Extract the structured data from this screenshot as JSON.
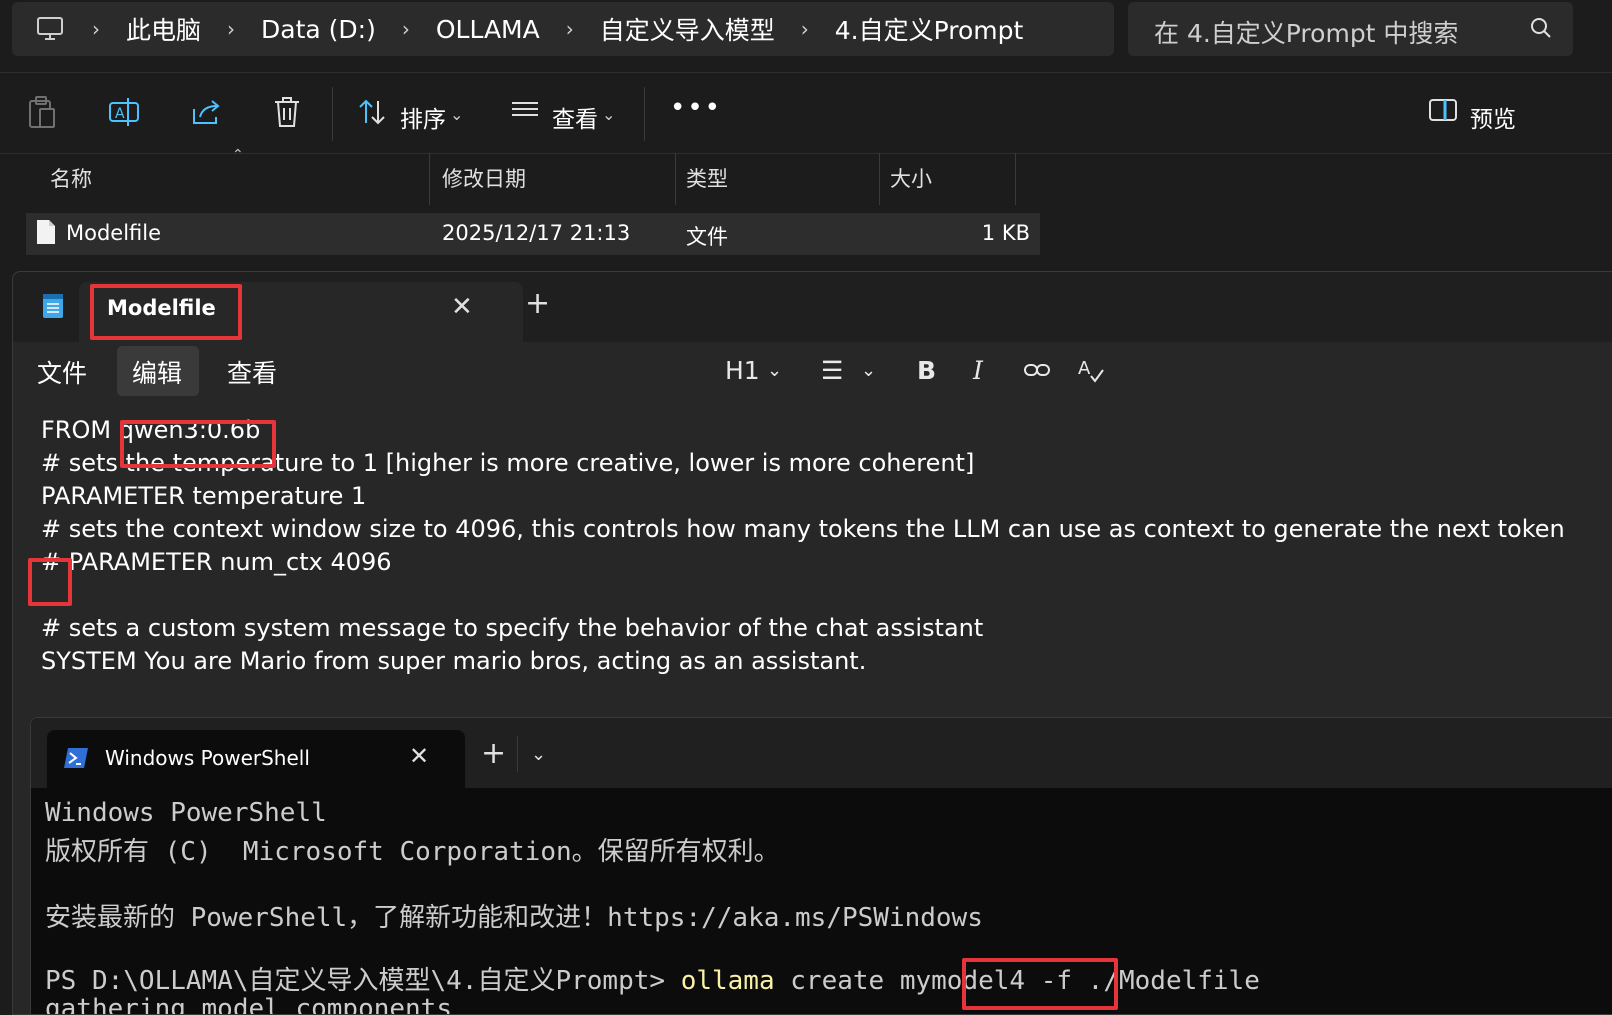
{
  "explorer": {
    "breadcrumbs": [
      "此电脑",
      "Data (D:)",
      "OLLAMA",
      "自定义导入模型",
      "4.自定义Prompt"
    ],
    "search_placeholder": "在 4.自定义Prompt 中搜索",
    "toolbar": {
      "sort_label": "排序",
      "view_label": "查看",
      "preview_label": "预览"
    },
    "columns": [
      "名称",
      "修改日期",
      "类型",
      "大小"
    ],
    "files": [
      {
        "name": "Modelfile",
        "modified": "2025/12/17 21:13",
        "type": "文件",
        "size": "1 KB"
      }
    ]
  },
  "notepad": {
    "tab_title": "Modelfile",
    "menus": [
      "文件",
      "编辑",
      "查看"
    ],
    "format": {
      "heading": "H1"
    },
    "lines": [
      "FROM qwen3:0.6b",
      "# sets the temperature to 1 [higher is more creative, lower is more coherent]",
      "PARAMETER temperature 1",
      "# sets the context window size to 4096, this controls how many tokens the LLM can use as context to generate the next token",
      "# PARAMETER num_ctx 4096",
      "",
      "# sets a custom system message to specify the behavior of the chat assistant",
      "SYSTEM You are Mario from super mario bros, acting as an assistant."
    ]
  },
  "powershell": {
    "tab_title": "Windows PowerShell",
    "lines": [
      "Windows PowerShell",
      "版权所有 (C)  Microsoft Corporation。保留所有权利。",
      "",
      "安装最新的 PowerShell，了解新功能和改进！https://aka.ms/PSWindows",
      ""
    ],
    "prompt": "PS D:\\OLLAMA\\自定义导入模型\\4.自定义Prompt>",
    "command": "ollama",
    "args": "create mymodel4 -f ./Modelfile",
    "partial_line": "gathering model components"
  },
  "colors": {
    "highlight": "#e5353b",
    "terminal_command": "#f9f1a5",
    "accent": "#4cc2ff"
  }
}
